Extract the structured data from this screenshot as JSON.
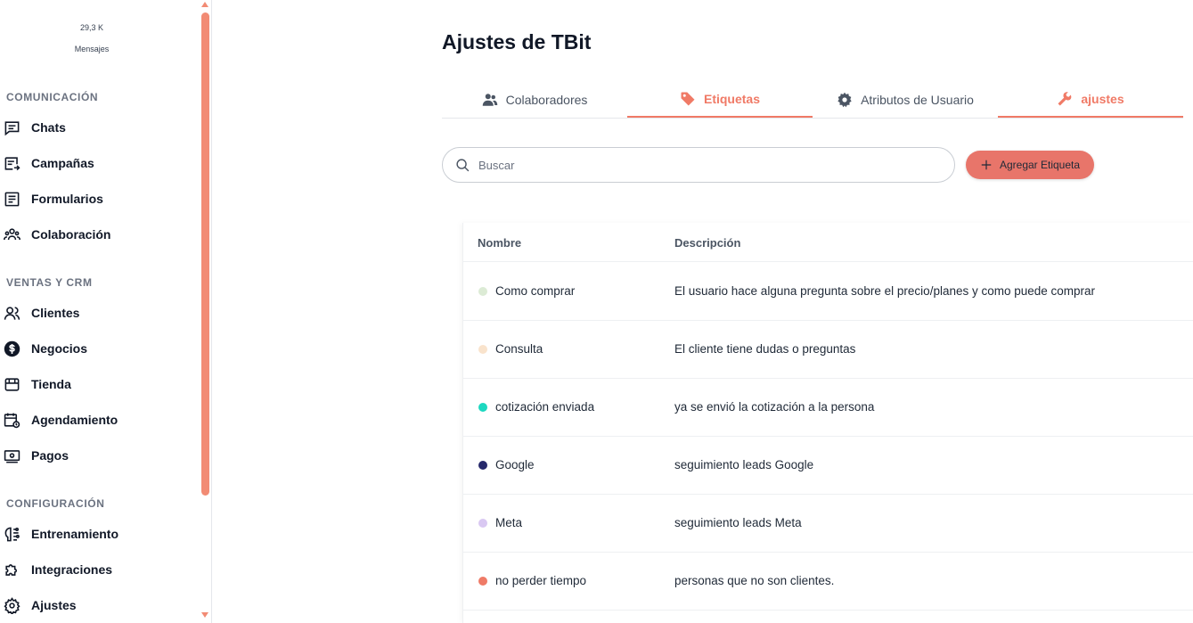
{
  "sidebar": {
    "usage_value": "29,3 K",
    "usage_label": "Mensajes",
    "sections": [
      {
        "title": "COMUNICACIÓN",
        "items": [
          "Chats",
          "Campañas",
          "Formularios",
          "Colaboración"
        ]
      },
      {
        "title": "VENTAS Y CRM",
        "items": [
          "Clientes",
          "Negocios",
          "Tienda",
          "Agendamiento",
          "Pagos"
        ]
      },
      {
        "title": "CONFIGURACIÓN",
        "items": [
          "Entrenamiento",
          "Integraciones",
          "Ajustes"
        ]
      }
    ]
  },
  "main": {
    "title": "Ajustes de TBit",
    "tabs": [
      {
        "label": "Colaboradores",
        "icon": "users-icon",
        "active": false
      },
      {
        "label": "Etiquetas",
        "icon": "tag-icon",
        "active": true
      },
      {
        "label": "Atributos de Usuario",
        "icon": "gear-icon",
        "active": false
      },
      {
        "label": "ajustes",
        "icon": "wrench-icon",
        "active": true
      }
    ],
    "search": {
      "placeholder": "Buscar",
      "value": ""
    },
    "add_button": "Agregar Etiqueta",
    "table": {
      "headers": [
        "Nombre",
        "Descripción"
      ],
      "rows": [
        {
          "name": "Como comprar",
          "description": "El usuario hace alguna pregunta sobre el precio/planes y como puede comprar",
          "color": "#dcebd5"
        },
        {
          "name": "Consulta",
          "description": "El cliente tiene dudas o preguntas",
          "color": "#f9e3cc"
        },
        {
          "name": "cotización enviada",
          "description": "ya se envió la cotización a la persona",
          "color": "#1dd8c0"
        },
        {
          "name": "Google",
          "description": "seguimiento leads Google",
          "color": "#26296b"
        },
        {
          "name": "Meta",
          "description": "seguimiento leads Meta",
          "color": "#d9c8f2"
        },
        {
          "name": "no perder tiempo",
          "description": "personas que no son clientes.",
          "color": "#ef7b67"
        }
      ]
    }
  },
  "colors": {
    "accent": "#f07a66",
    "button": "#e8756a",
    "scrollbar": "#f28b74"
  }
}
